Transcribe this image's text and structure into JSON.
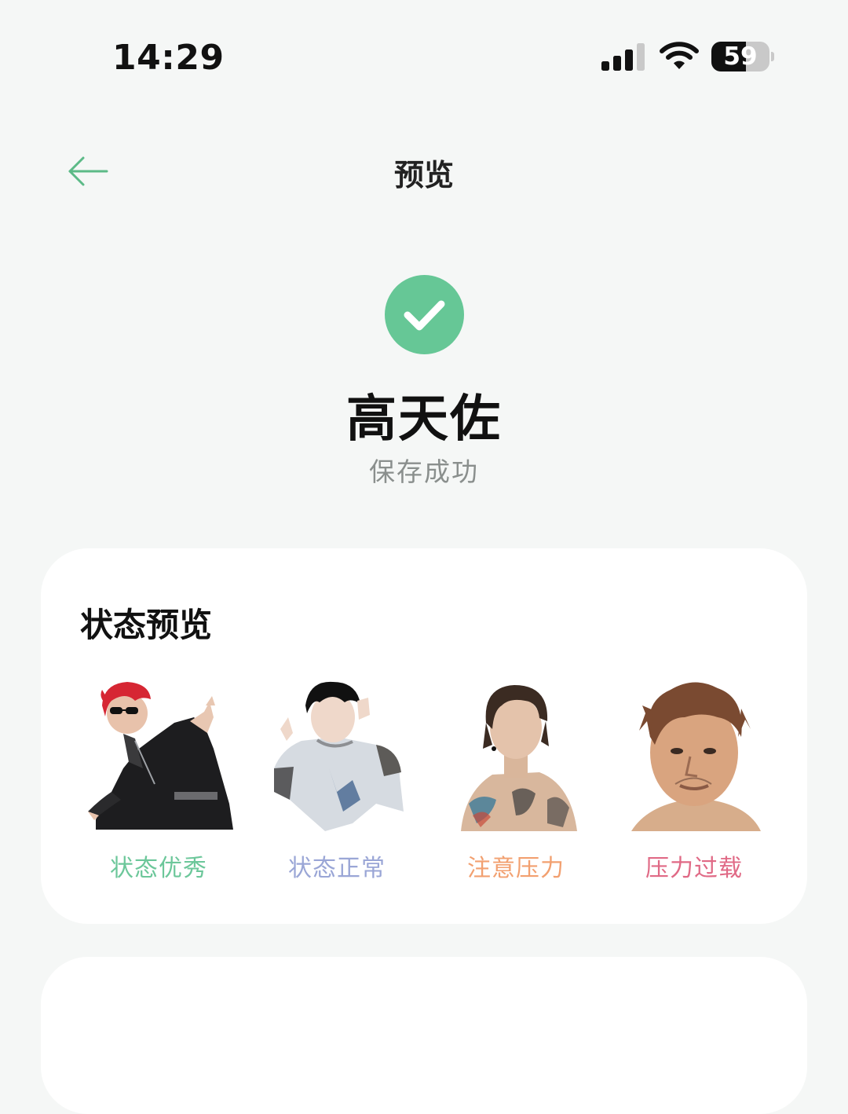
{
  "status_bar": {
    "time": "14:29",
    "battery": "59",
    "battery_level": 0.59,
    "icons": [
      "signal-icon",
      "wifi-icon",
      "battery-icon"
    ]
  },
  "nav": {
    "back_icon": "arrow-left-icon",
    "title": "预览"
  },
  "success": {
    "icon": "check-circle-icon",
    "name": "高天佐",
    "subtitle": "保存成功"
  },
  "preview_card": {
    "title": "状态预览",
    "items": [
      {
        "label": "状态优秀",
        "color": "#6cc79a",
        "image": "red-hair-sunglasses-dancer"
      },
      {
        "label": "状态正常",
        "color": "#9aa6d6",
        "image": "dark-hair-shirt-portrait"
      },
      {
        "label": "注意压力",
        "color": "#f2a070",
        "image": "tattooed-shirtless-portrait"
      },
      {
        "label": "压力过载",
        "color": "#e06a86",
        "image": "messy-hair-face-portrait"
      }
    ]
  },
  "colors": {
    "accent": "#66c796",
    "background": "#f5f7f6"
  }
}
